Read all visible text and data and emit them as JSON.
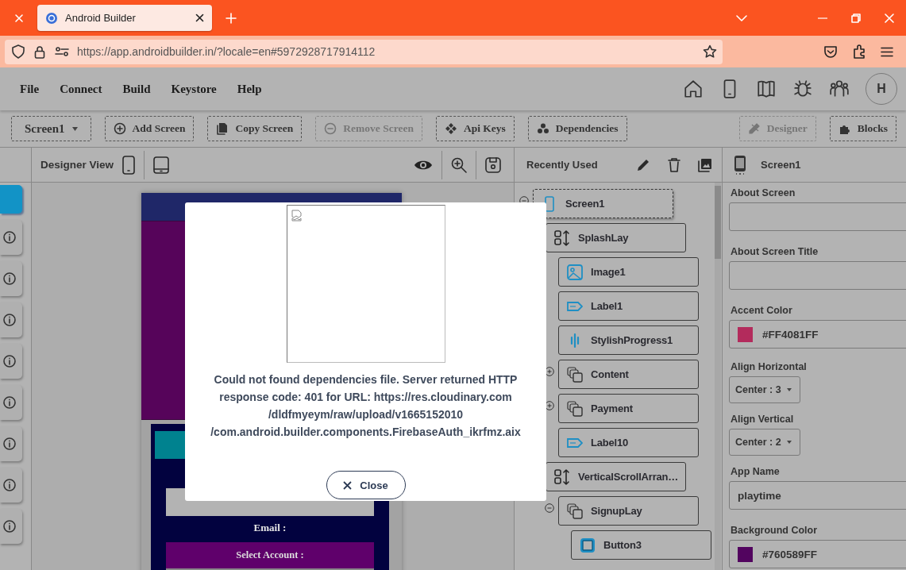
{
  "browser": {
    "tab": {
      "title": "Android Builder",
      "selected": true
    },
    "url": "https://app.androidbuilder.in/?locale=en#5972928717914112"
  },
  "menu": [
    "File",
    "Connect",
    "Build",
    "Keystore",
    "Help"
  ],
  "avatar": "H",
  "toolbar": {
    "screen_select": "Screen1",
    "buttons": [
      {
        "label": "Add Screen",
        "disabled": false
      },
      {
        "label": "Copy Screen",
        "disabled": false
      },
      {
        "label": "Remove Screen",
        "disabled": true
      },
      {
        "label": "Api Keys",
        "disabled": false
      },
      {
        "label": "Dependencies",
        "disabled": false
      }
    ],
    "views": [
      {
        "label": "Designer",
        "disabled": true
      },
      {
        "label": "Blocks",
        "disabled": false
      }
    ]
  },
  "palette": [
    {
      "selected": true
    },
    {
      "selected": false
    },
    {
      "selected": false
    },
    {
      "selected": false
    },
    {
      "selected": false
    },
    {
      "selected": false
    },
    {
      "selected": false
    },
    {
      "selected": false
    },
    {
      "selected": false
    }
  ],
  "designer": {
    "title": "Designer View",
    "phone": {
      "email_label": "Email :",
      "select_button": "Select Account :"
    }
  },
  "tree": {
    "title": "Recently Used",
    "nodes": [
      {
        "label": "Screen1",
        "kind": "screen",
        "selected": true,
        "expanded": true,
        "children": [
          {
            "label": "SplashLay",
            "kind": "arrangement",
            "selected": false,
            "children": [
              {
                "label": "Image1",
                "kind": "image",
                "selected": false
              },
              {
                "label": "Label1",
                "kind": "label",
                "selected": false
              },
              {
                "label": "StylishProgress1",
                "kind": "progress",
                "selected": false
              },
              {
                "label": "Content",
                "kind": "group",
                "selected": false,
                "expanded": false
              },
              {
                "label": "Payment",
                "kind": "group",
                "selected": false,
                "expanded": false
              },
              {
                "label": "Label10",
                "kind": "label",
                "selected": false
              }
            ]
          },
          {
            "label": "VerticalScrollArran…",
            "kind": "arrangement",
            "selected": false,
            "children": [
              {
                "label": "SignupLay",
                "kind": "group",
                "selected": false,
                "expanded": true,
                "children": [
                  {
                    "label": "Button3",
                    "kind": "button",
                    "selected": false
                  }
                ]
              }
            ]
          }
        ]
      }
    ]
  },
  "properties": {
    "title": "Screen1",
    "items": [
      {
        "kind": "text",
        "label": "About Screen"
      },
      {
        "kind": "text",
        "label": "About Screen Title"
      },
      {
        "kind": "color",
        "label": "Accent Color",
        "value": "#FF4081FF",
        "color": "#b32b5c"
      },
      {
        "kind": "select",
        "label": "Align Horizontal",
        "value": "Center : 3"
      },
      {
        "kind": "select",
        "label": "Align Vertical",
        "value": "Center : 2"
      },
      {
        "kind": "text",
        "label": "App Name",
        "value": "playtime"
      },
      {
        "kind": "color",
        "label": "Background Color",
        "value": "#760589FF",
        "color": "#52045f"
      }
    ]
  },
  "dialog": {
    "message": "Could not found dependencies file. Server returned HTTP\nresponse code: 401 for URL: https://res.cloudinary.com\n/dldfmyeym/raw/upload/v1665152010\n/com.android.builder.components.FirebaseAuth_ikrfmz.aix",
    "close": "Close"
  }
}
